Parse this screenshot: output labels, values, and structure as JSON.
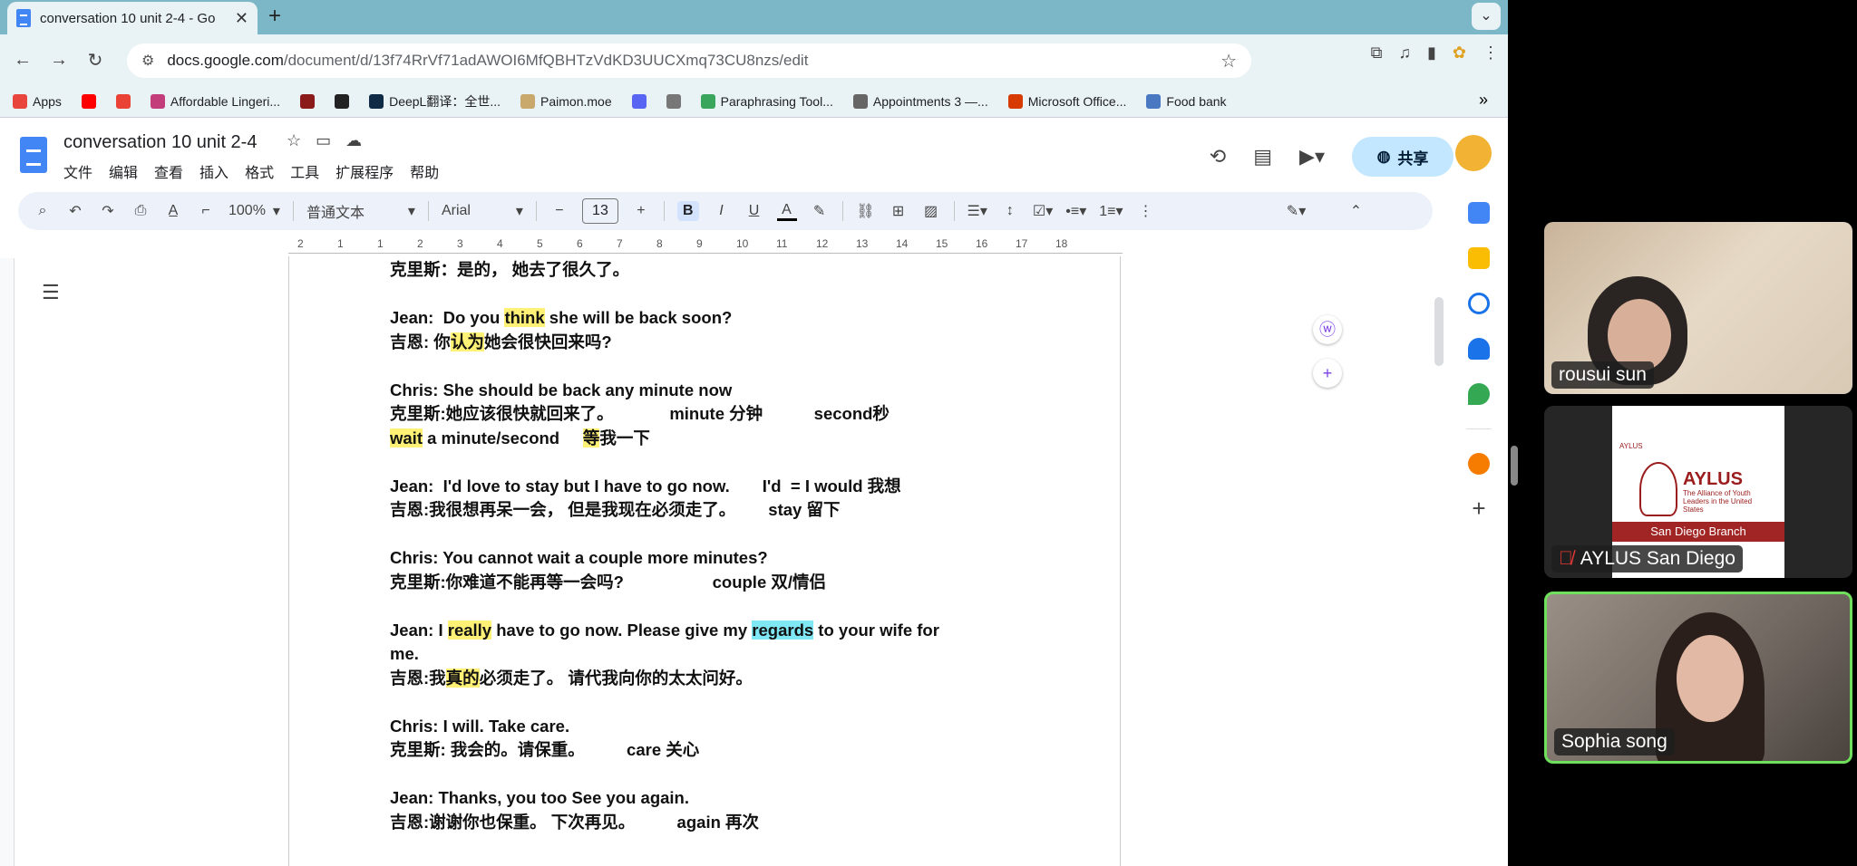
{
  "browser": {
    "tab_title": "conversation 10 unit 2-4 - Go",
    "url_domain": "docs.google.com",
    "url_path": "/document/d/13f74RrVf71adAWOI6MfQBHTzVdKD3UUCXmq73CU8nzs/edit",
    "bookmarks": [
      {
        "label": "Apps",
        "color": "#e8453c"
      },
      {
        "label": "",
        "color": "#ff0000"
      },
      {
        "label": "",
        "color": "#ea4335"
      },
      {
        "label": "Affordable Lingeri...",
        "color": "#c33d7a"
      },
      {
        "label": "",
        "color": "#8b1a1a"
      },
      {
        "label": "",
        "color": "#222222"
      },
      {
        "label": "DeepL翻译：全世...",
        "color": "#0f2b46"
      },
      {
        "label": "Paimon.moe",
        "color": "#c8a96b"
      },
      {
        "label": "",
        "color": "#5865f2"
      },
      {
        "label": "",
        "color": "#777777"
      },
      {
        "label": "Paraphrasing Tool...",
        "color": "#3aa55d"
      },
      {
        "label": "Appointments 3 —...",
        "color": "#666666"
      },
      {
        "label": "Microsoft Office...",
        "color": "#d83b01"
      },
      {
        "label": "Food bank",
        "color": "#4a78c2"
      }
    ]
  },
  "docs": {
    "title": "conversation 10 unit 2-4",
    "menu": [
      "文件",
      "编辑",
      "查看",
      "插入",
      "格式",
      "工具",
      "扩展程序",
      "帮助"
    ],
    "share_label": "共享",
    "toolbar": {
      "zoom": "100%",
      "style": "普通文本",
      "font": "Arial",
      "font_size": "13"
    },
    "ruler_ticks": [
      "2",
      "1",
      "1",
      "2",
      "3",
      "4",
      "5",
      "6",
      "7",
      "8",
      "9",
      "10",
      "11",
      "12",
      "13",
      "14",
      "15",
      "16",
      "17",
      "18"
    ]
  },
  "document_lines": [
    "克里斯：是的， 她去了很久了。",
    "",
    "Jean:  Do you think she will be back soon?",
    "吉恩: 你认为她会很快回来吗?",
    "",
    "Chris: She should be back any minute now",
    "克里斯:她应该很快就回来了。            minute 分钟           second秒",
    "wait a minute/second     等我一下",
    "",
    "Jean:  I'd love to stay but I have to go now.       I'd  = I would 我想",
    "吉恩:我很想再呆一会， 但是我现在必须走了。       stay 留下",
    "",
    "Chris: You cannot wait a couple more minutes?",
    "克里斯:你难道不能再等一会吗?                   couple 双/情侣",
    "",
    "Jean: I really have to go now. Please give my regards to your wife for",
    "me.",
    "吉恩:我真的必须走了。 请代我向你的太太问好。",
    "",
    "Chris: I will. Take care.",
    "克里斯: 我会的。请保重。         care 关心",
    "",
    "Jean: Thanks, you too See you again.",
    "吉恩:谢谢你也保重。 下次再见。         again 再次"
  ],
  "participants": [
    {
      "name": "rousui sun"
    },
    {
      "name": "AYLUS San Diego",
      "muted": true,
      "card_title": "AYLUS",
      "card_sub": "The Alliance of Youth Leaders in the United States",
      "card_band": "San Diego Branch",
      "card_mini": "AYLUS"
    },
    {
      "name": "Sophia song",
      "active_speaker": true
    }
  ]
}
